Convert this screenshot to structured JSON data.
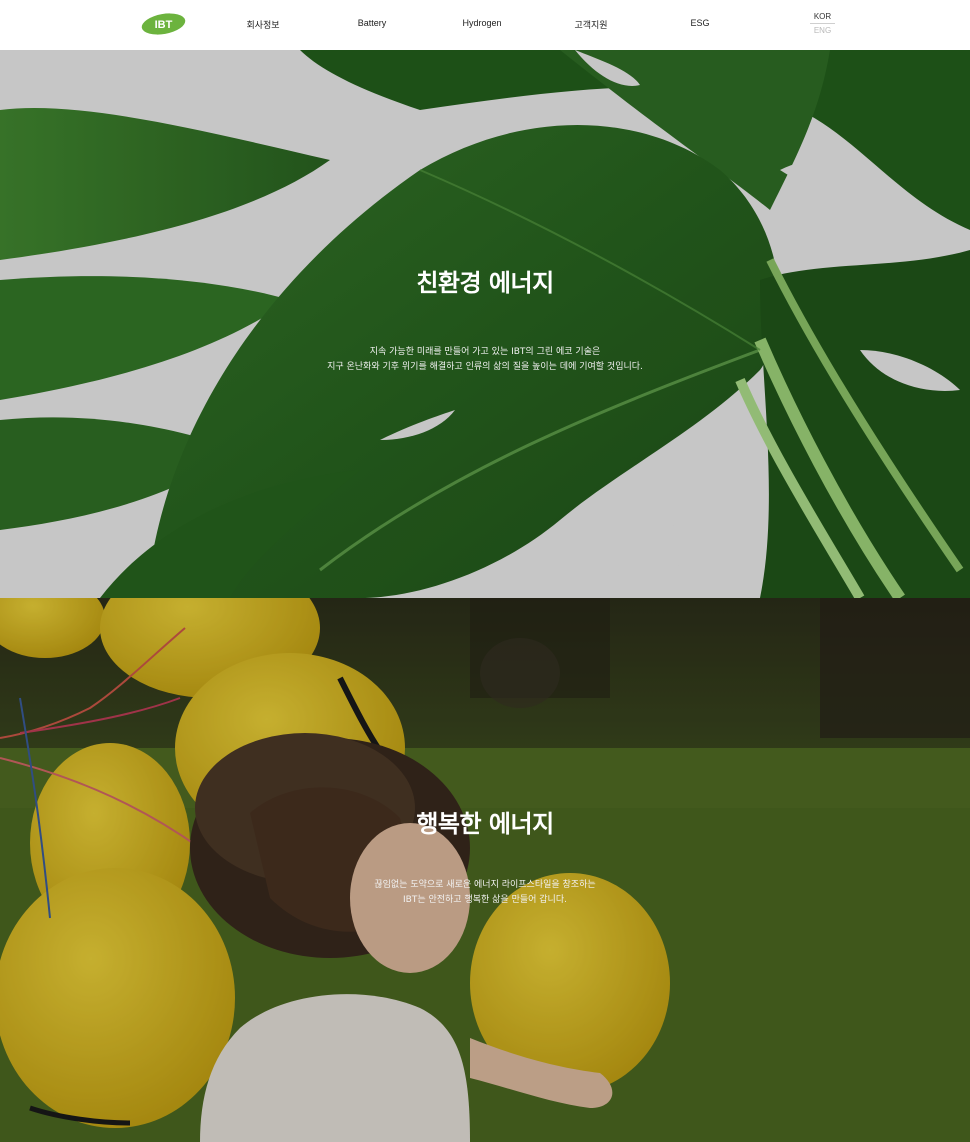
{
  "header": {
    "logo_text": "IBT",
    "nav": [
      "회사정보",
      "Battery",
      "Hydrogen",
      "고객지원",
      "ESG"
    ],
    "languages": {
      "active": "KOR",
      "inactive": "ENG"
    }
  },
  "sections": [
    {
      "title": "친환경 에너지",
      "lines": [
        "지속 가능한 미래를 만들어 가고 있는 IBT의 그린 에코 기술은",
        "지구 온난화와 기후 위기를 해결하고 인류의 삶의 질을 높이는 데에 기여할 것입니다."
      ]
    },
    {
      "title": "행복한 에너지",
      "lines": [
        "끊임없는 도약으로 새로운 에너지 라이프스타일을 창조하는",
        "IBT는 안전하고 행복한 삶을 만들어 갑니다."
      ]
    }
  ],
  "colors": {
    "brand_green": "#6cb33e",
    "leaf_dark": "#1f5a1e",
    "balloon_yellow": "#e6c31c",
    "grass": "#4f6b22"
  }
}
